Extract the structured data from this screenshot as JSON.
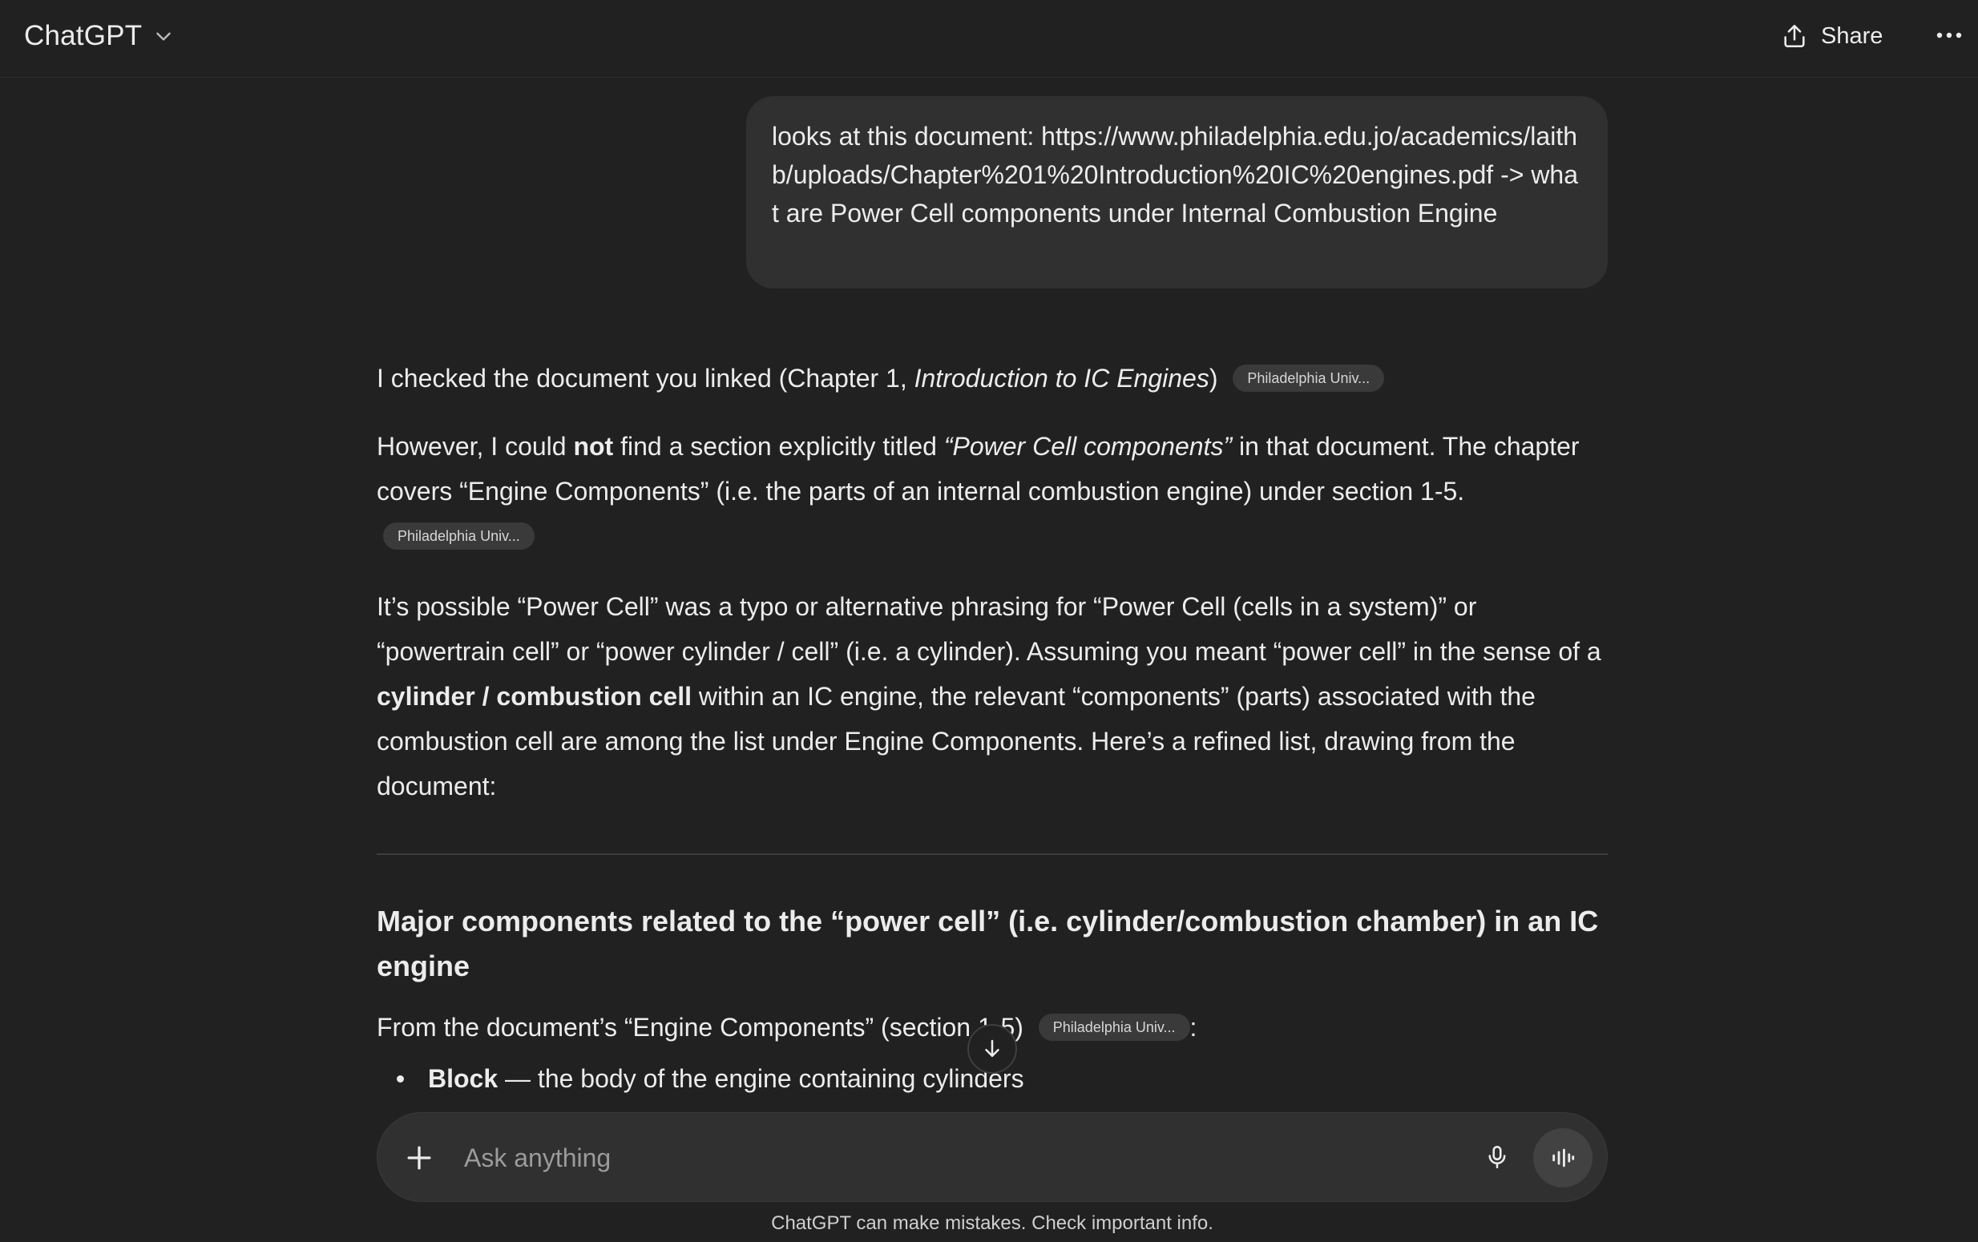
{
  "header": {
    "model_name": "ChatGPT",
    "share_label": "Share"
  },
  "user_message": {
    "text": "looks at this document: https://www.philadelphia.edu.jo/academics/laithb/uploads/Chapter%201%20Introduction%20IC%20engines.pdf -> what are Power Cell components under Internal Combustion Engine"
  },
  "assistant": {
    "p1": {
      "before": "I checked the document you linked (Chapter 1, ",
      "italic": "Introduction to IC Engines",
      "after": ")",
      "source_chip": "Philadelphia Univ..."
    },
    "p2": {
      "a": "However, I could ",
      "bold": "not",
      "b": " find a section explicitly titled ",
      "italic": "“Power Cell components”",
      "c": " in that document. The chapter covers “Engine Components” (i.e. the parts of an internal combustion engine) under section 1-5.",
      "source_chip": "Philadelphia Univ..."
    },
    "p3": {
      "a": "It’s possible “Power Cell” was a typo or alternative phrasing for “Power Cell (cells in a system)” or “powertrain cell” or “power cylinder / cell” (i.e. a cylinder). Assuming you meant “power cell” in the sense of a ",
      "bold": "cylinder / combustion cell",
      "b": " within an IC engine, the relevant “components” (parts) associated with the combustion cell are among the list under Engine Components. Here’s a refined list, drawing from the document:"
    },
    "heading": "Major components related to the “power cell” (i.e. cylinder/combustion chamber) in an IC engine",
    "p4": {
      "text": "From the document’s “Engine Components” (section 1-5)",
      "source_chip": "Philadelphia Univ...",
      "after": ":"
    },
    "bullets": [
      {
        "bold": "Block",
        "text": " — the body of the engine containing cylinders"
      }
    ]
  },
  "composer": {
    "placeholder": "Ask anything"
  },
  "footer": {
    "disclaimer": "ChatGPT can make mistakes. Check important info."
  },
  "icons": {
    "model_dropdown": "chevron-down-icon",
    "share": "share-upload-icon",
    "more": "more-horizontal-icon",
    "scroll": "arrow-down-icon",
    "plus": "plus-icon",
    "mic": "microphone-icon",
    "voice": "voice-waveform-icon"
  },
  "colors": {
    "background": "#212121",
    "bubble": "#303030",
    "text": "#ececec",
    "chip": "#3a3a3a"
  }
}
